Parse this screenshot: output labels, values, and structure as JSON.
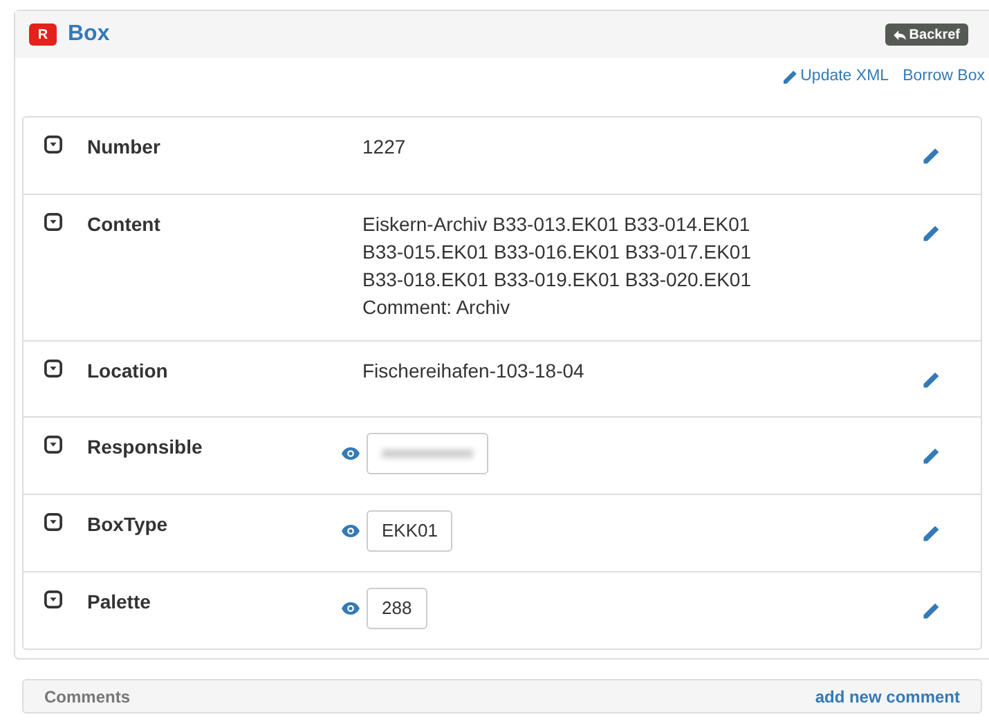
{
  "header": {
    "badge": "R",
    "title": "Box",
    "backref_button": "Backref"
  },
  "actions": [
    {
      "label": "Update XML",
      "kind": "edit"
    },
    {
      "label": "Borrow Box",
      "kind": "plain"
    }
  ],
  "fields": [
    {
      "label": "Number",
      "kind": "text",
      "lines": [
        "1227"
      ]
    },
    {
      "label": "Content",
      "kind": "text",
      "lines": [
        "Eiskern-Archiv B33-013.EK01 B33-014.EK01",
        "B33-015.EK01 B33-016.EK01 B33-017.EK01",
        "B33-018.EK01 B33-019.EK01 B33-020.EK01",
        "Comment: Archiv"
      ]
    },
    {
      "label": "Location",
      "kind": "text",
      "lines": [
        "Fischereihafen-103-18-04"
      ]
    },
    {
      "label": "Responsible",
      "kind": "redacted"
    },
    {
      "label": "BoxType",
      "kind": "link",
      "value": "EKK01"
    },
    {
      "label": "Palette",
      "kind": "link",
      "value": "288"
    }
  ],
  "comments": {
    "title": "Comments",
    "add_link": "add new comment"
  }
}
